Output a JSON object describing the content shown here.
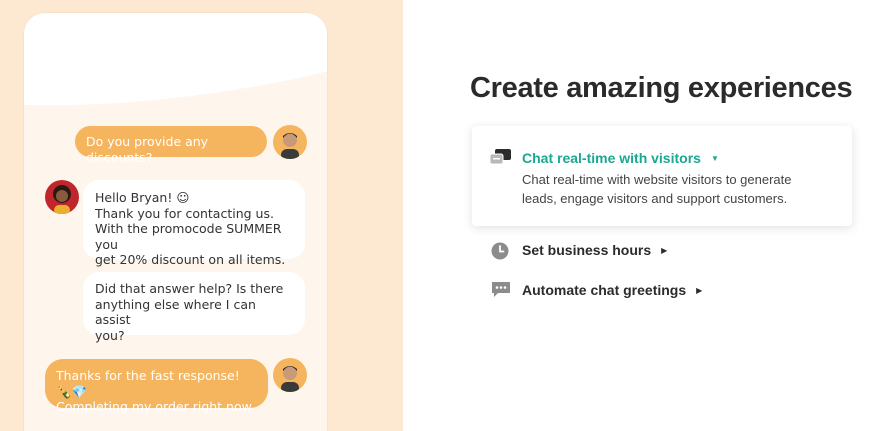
{
  "chat": {
    "messages": [
      {
        "from": "visitor",
        "text": "Do you provide any discounts?"
      },
      {
        "from": "agent",
        "text": "Hello Bryan! ☺\nThank you for contacting us.\nWith the promocode SUMMER you\nget 20% discount on all items."
      },
      {
        "from": "agent",
        "text": "Did that answer help? Is there\nanything else where I can assist\nyou?"
      },
      {
        "from": "visitor",
        "text": "Thanks for the fast response! 🍾💎\nCompleting my order right now."
      }
    ]
  },
  "headline": "Create amazing experiences",
  "features": [
    {
      "title": "Chat real-time with visitors",
      "description": "Chat real-time with website visitors to generate leads, engage visitors and support customers.",
      "icon": "chat-bubbles-icon",
      "expanded": true
    },
    {
      "title": "Set business hours",
      "icon": "clock-icon",
      "expanded": false
    },
    {
      "title": "Automate chat greetings",
      "icon": "chat-dots-icon",
      "expanded": false
    }
  ],
  "colors": {
    "accent": "#1aa88f",
    "bubble_out": "#f5b45e",
    "left_bg": "#fde9d2",
    "text_dark": "#2b2b2b"
  }
}
